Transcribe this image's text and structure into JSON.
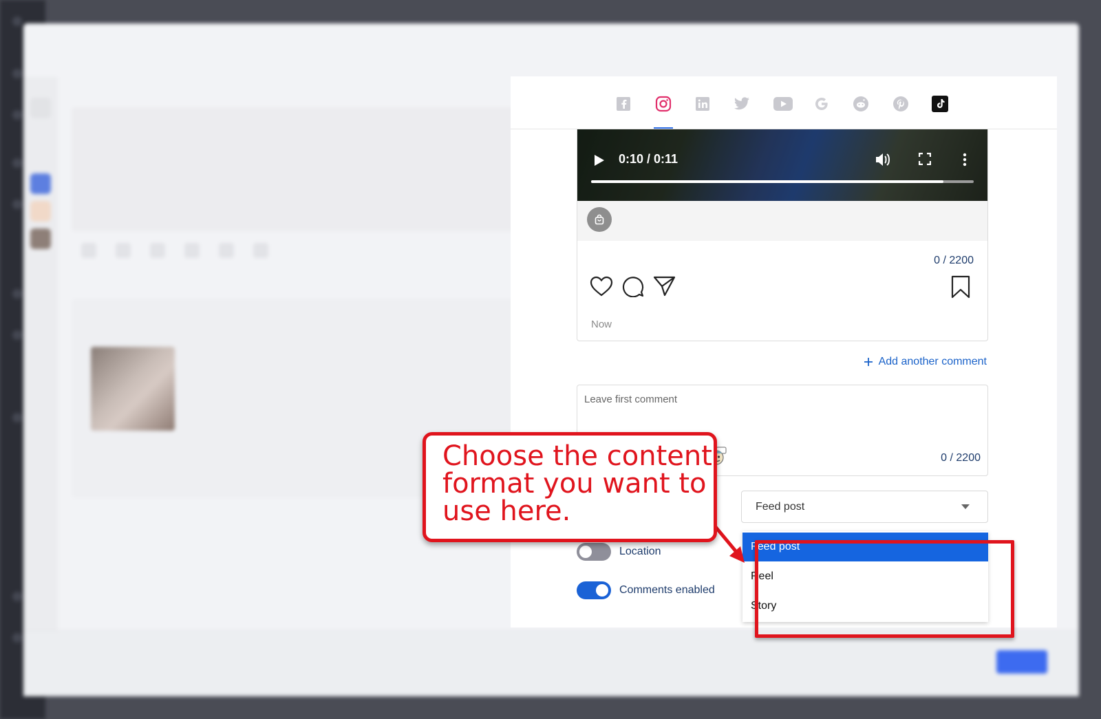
{
  "preview": {
    "video": {
      "time": "0:10 / 0:11",
      "progress": 0.92
    },
    "caption_count": "0 / 2200",
    "timestamp": "Now"
  },
  "comments": {
    "add_label": "Add another comment",
    "first_placeholder": "Leave first comment",
    "count": "0 / 2200"
  },
  "format_select": {
    "value": "Feed post",
    "options": [
      "Feed post",
      "Reel",
      "Story"
    ],
    "selected_index": 0
  },
  "toggles": {
    "location": {
      "label": "Location",
      "on": false
    },
    "comments": {
      "label": "Comments enabled",
      "on": true
    }
  },
  "annotation": {
    "text": "Choose the content format you want to use here."
  },
  "colors": {
    "accent": "#1565e0",
    "annotation_red": "#e0141d",
    "toggle_on": "#1a62d6",
    "toggle_off": "#8f8f9a",
    "text_navy": "#1d3b6b"
  },
  "networks": [
    "facebook-icon",
    "instagram-icon",
    "linkedin-icon",
    "twitter-icon",
    "youtube-icon",
    "google-icon",
    "reddit-icon",
    "pinterest-icon",
    "tiktok-icon"
  ]
}
